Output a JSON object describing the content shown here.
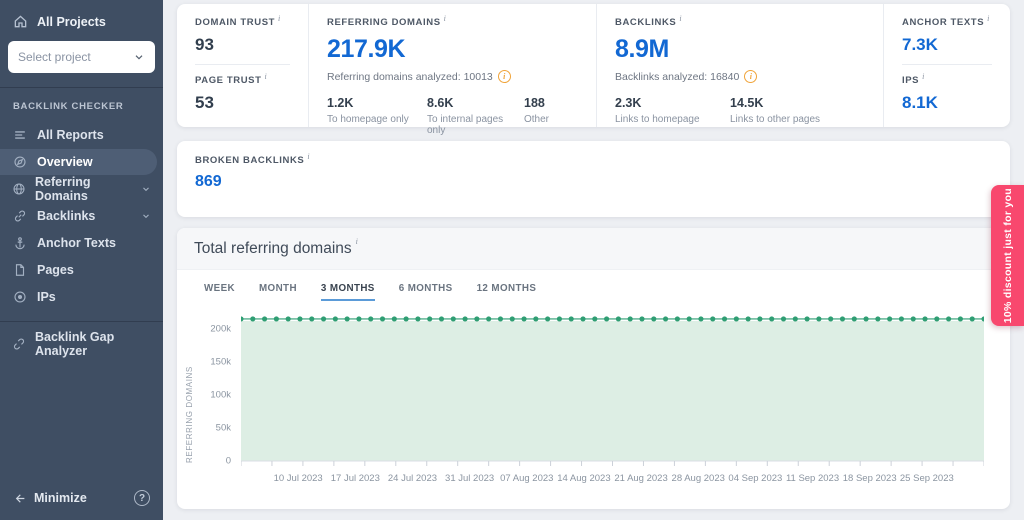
{
  "ui": {
    "info_glyph": "i",
    "help_glyph": "?"
  },
  "sidebar": {
    "all_projects": "All Projects",
    "project_select": {
      "placeholder": "Select project"
    },
    "section_label": "BACKLINK CHECKER",
    "items": [
      {
        "label": "All Reports"
      },
      {
        "label": "Overview",
        "active": true
      },
      {
        "label": "Referring Domains",
        "expandable": true
      },
      {
        "label": "Backlinks",
        "expandable": true
      },
      {
        "label": "Anchor Texts"
      },
      {
        "label": "Pages"
      },
      {
        "label": "IPs"
      }
    ],
    "gap_analyzer": "Backlink Gap Analyzer",
    "minimize_label": "Minimize"
  },
  "metrics": {
    "domain_trust": {
      "label": "DOMAIN TRUST",
      "value": "93"
    },
    "page_trust": {
      "label": "PAGE TRUST",
      "value": "53"
    },
    "referring_domains": {
      "label": "REFERRING DOMAINS",
      "value": "217.9K",
      "analyzed": "Referring domains analyzed: 10013",
      "breakdown": [
        {
          "value": "1.2K",
          "label": "To homepage only"
        },
        {
          "value": "8.6K",
          "label": "To internal pages only"
        },
        {
          "value": "188",
          "label": "Other"
        }
      ]
    },
    "backlinks": {
      "label": "BACKLINKS",
      "value": "8.9M",
      "analyzed": "Backlinks analyzed: 16840",
      "breakdown": [
        {
          "value": "2.3K",
          "label": "Links to homepage"
        },
        {
          "value": "14.5K",
          "label": "Links to other pages"
        }
      ]
    },
    "anchor_texts": {
      "label": "ANCHOR TEXTS",
      "value": "7.3K"
    },
    "ips": {
      "label": "IPS",
      "value": "8.1K"
    },
    "broken_backlinks": {
      "label": "BROKEN BACKLINKS",
      "value": "869"
    }
  },
  "chart": {
    "tabs": [
      "WEEK",
      "MONTH",
      "3 MONTHS",
      "6 MONTHS",
      "12 MONTHS"
    ],
    "active_tab": "3 MONTHS"
  },
  "chart_data": {
    "type": "line",
    "title": "Total referring domains",
    "ylabel": "REFERRING DOMAINS",
    "ylim": [
      0,
      227000
    ],
    "yticks": [
      0,
      50000,
      100000,
      150000,
      200000
    ],
    "ytick_labels": [
      "0",
      "50k",
      "100k",
      "150k",
      "200k"
    ],
    "x": [
      "10 Jul 2023",
      "17 Jul 2023",
      "24 Jul 2023",
      "31 Jul 2023",
      "07 Aug 2023",
      "14 Aug 2023",
      "21 Aug 2023",
      "28 Aug 2023",
      "04 Sep 2023",
      "11 Sep 2023",
      "18 Sep 2023",
      "25 Sep 2023"
    ],
    "series": [
      {
        "name": "Referring domains",
        "values": [
          215000,
          215000,
          215000,
          215000,
          215000,
          215000,
          215000,
          215000,
          215000,
          215000,
          215000,
          215000
        ]
      }
    ],
    "marker_points": 64,
    "line_color": "#2f9e73",
    "fill_color": "#ddeee4",
    "grid": false,
    "legend": "none"
  },
  "promo_ribbon": {
    "text": "10% discount just for you",
    "color": "#f8486e"
  }
}
